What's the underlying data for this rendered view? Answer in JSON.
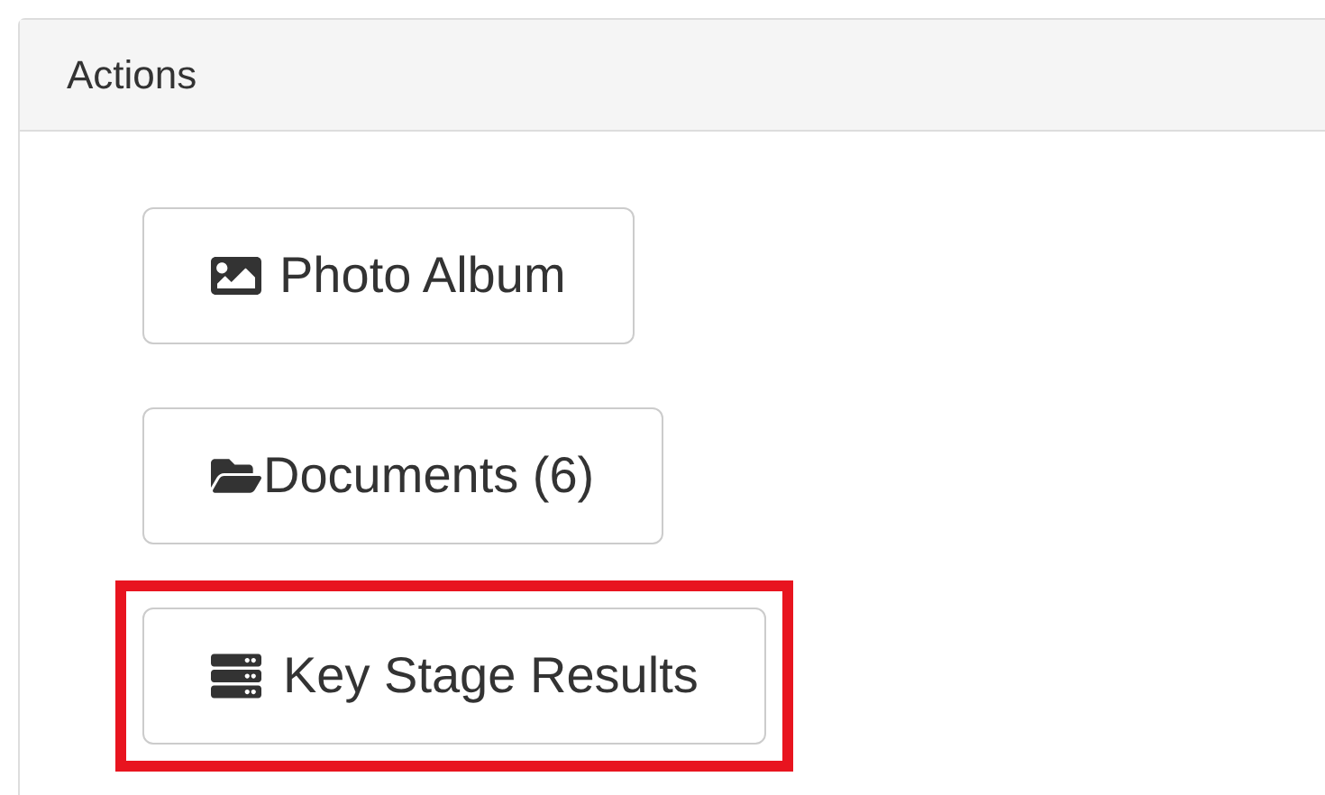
{
  "panel": {
    "title": "Actions"
  },
  "buttons": [
    {
      "kind": "photo",
      "label": "Photo Album",
      "highlighted": false
    },
    {
      "kind": "folder",
      "label": "Documents (6)",
      "highlighted": false
    },
    {
      "kind": "server",
      "label": "Key Stage Results",
      "highlighted": true
    }
  ]
}
